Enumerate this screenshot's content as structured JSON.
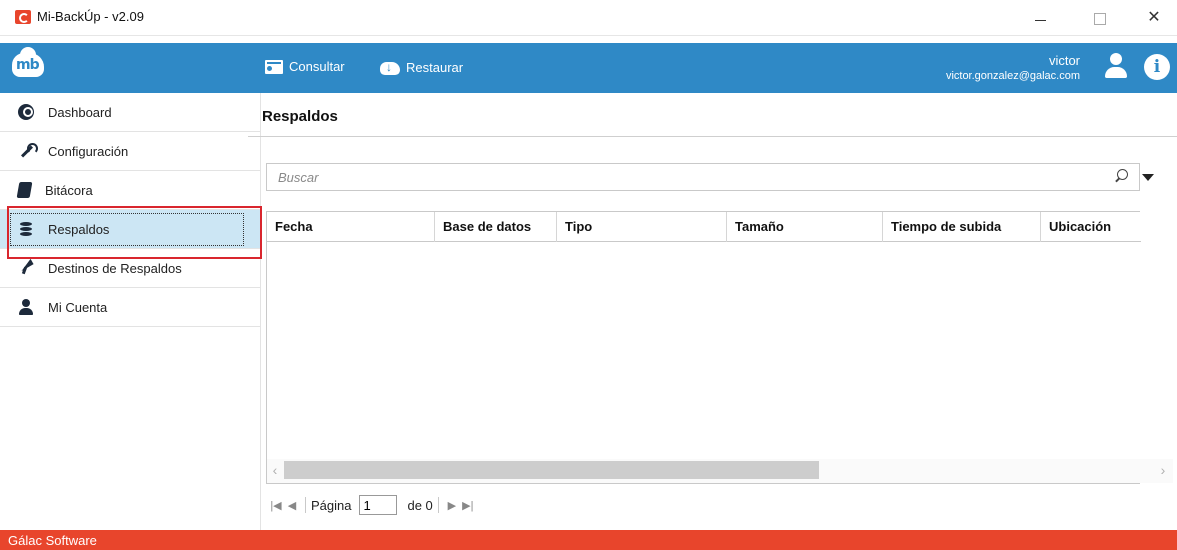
{
  "window": {
    "title": "Mi-BackÚp - v2.09",
    "controls": {
      "minimize": "—",
      "maximize": "☐",
      "close": "✕"
    }
  },
  "header": {
    "brand_text": "mb",
    "buttons": [
      {
        "label": "Consultar",
        "icon": "list-icon"
      },
      {
        "label": "Restaurar",
        "icon": "cloud-download-icon"
      }
    ],
    "user": {
      "name": "victor",
      "email": "victor.gonzalez@galac.com"
    },
    "accent_color": "#2f89c6"
  },
  "sidebar": {
    "items": [
      {
        "label": "Dashboard",
        "icon": "dashboard-icon"
      },
      {
        "label": "Configuración",
        "icon": "wrench-icon"
      },
      {
        "label": "Bitácora",
        "icon": "book-icon"
      },
      {
        "label": "Respaldos",
        "icon": "database-icon",
        "active": true
      },
      {
        "label": "Destinos de Respaldos",
        "icon": "location-arrow-icon"
      },
      {
        "label": "Mi Cuenta",
        "icon": "user-icon"
      }
    ]
  },
  "main": {
    "title": "Respaldos",
    "search": {
      "placeholder": "Buscar",
      "value": ""
    },
    "table": {
      "columns": [
        "Fecha",
        "Base de datos",
        "Tipo",
        "Tamaño",
        "Tiempo de subida",
        "Ubicación"
      ],
      "rows": []
    },
    "pager": {
      "page_label": "Página",
      "current_page": "1",
      "of_label": "de 0"
    }
  },
  "statusbar": {
    "text": "Gálac Software",
    "color": "#e8452c"
  }
}
